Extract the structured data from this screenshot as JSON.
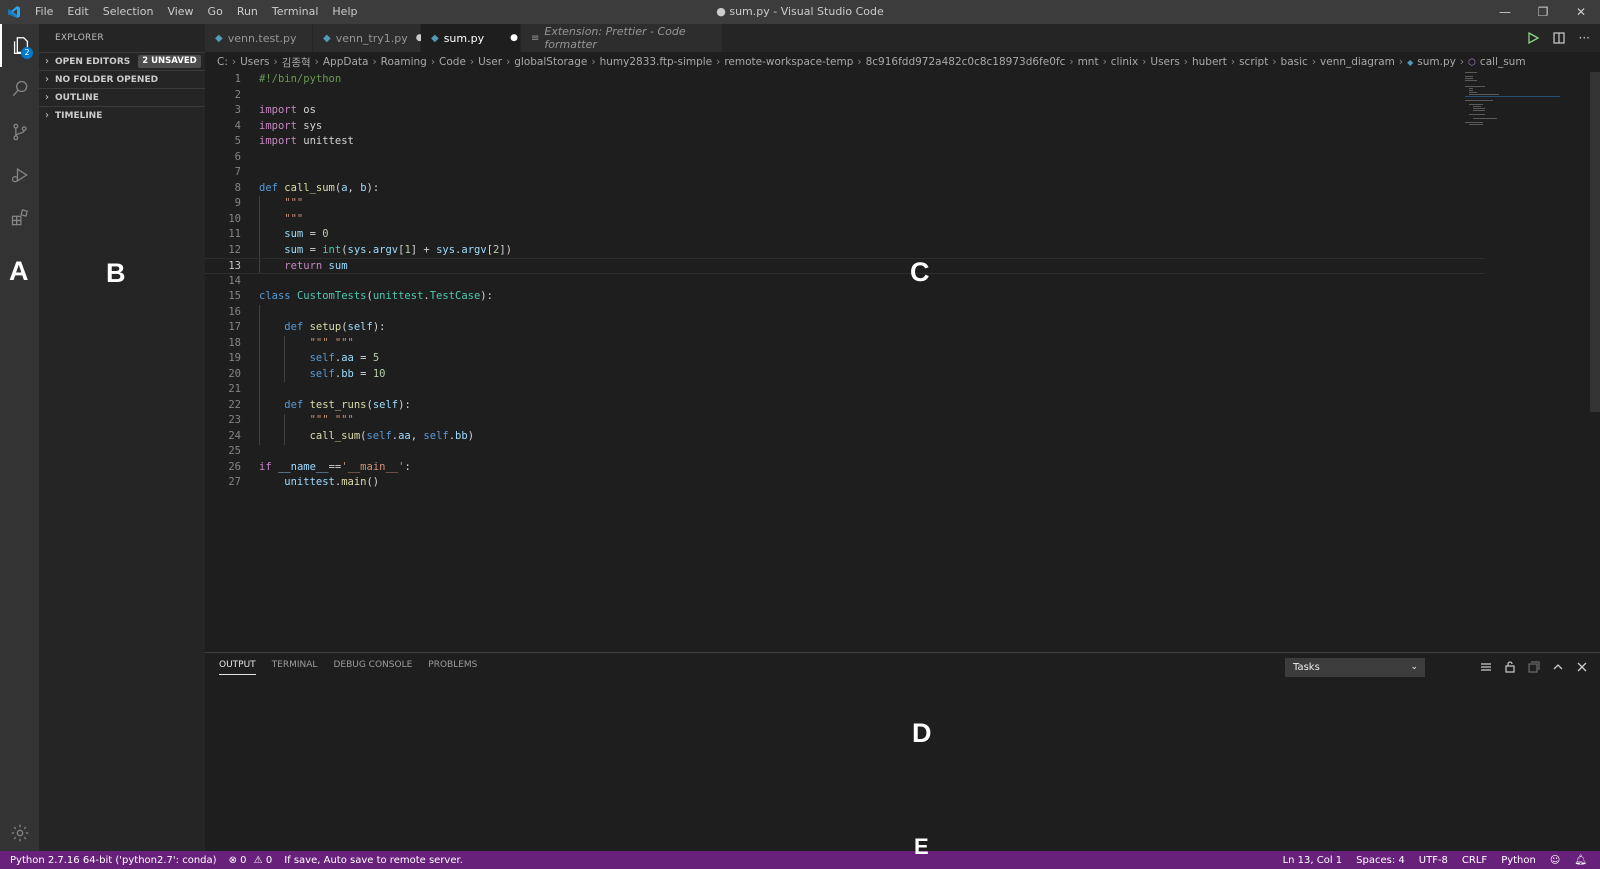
{
  "titlebar": {
    "menu": [
      "File",
      "Edit",
      "Selection",
      "View",
      "Go",
      "Run",
      "Terminal",
      "Help"
    ],
    "title": "● sum.py - Visual Studio Code",
    "controls": {
      "minimize": "—",
      "restore": "❐",
      "close": "✕"
    }
  },
  "activitybar": {
    "explorer_badge": "2",
    "icons": [
      "files-icon",
      "search-icon",
      "source-control-icon",
      "run-debug-icon",
      "extensions-icon"
    ],
    "bottom_icon": "gear-icon"
  },
  "sidebar": {
    "header": "EXPLORER",
    "sections": [
      {
        "label": "OPEN EDITORS",
        "badge": "2 UNSAVED"
      },
      {
        "label": "NO FOLDER OPENED"
      },
      {
        "label": "OUTLINE"
      },
      {
        "label": "TIMELINE"
      }
    ]
  },
  "tabs": [
    {
      "label": "venn.test.py",
      "dirty": ""
    },
    {
      "label": "venn_try1.py",
      "dirty": "●"
    },
    {
      "label": "sum.py",
      "dirty": "●"
    },
    {
      "label": "Extension: Prettier - Code formatter",
      "dirty": ""
    }
  ],
  "breadcrumb": [
    "C:",
    "Users",
    "김종혁",
    "AppData",
    "Roaming",
    "Code",
    "User",
    "globalStorage",
    "humy2833.ftp-simple",
    "remote-workspace-temp",
    "8c916fdd972a482c0c8c18973d6fe0fc",
    "mnt",
    "clinix",
    "Users",
    "hubert",
    "script",
    "basic",
    "venn_diagram",
    "sum.py",
    "call_sum"
  ],
  "editor": {
    "current_line": 13,
    "lines": [
      {
        "n": "1",
        "code": [
          [
            "cmt",
            "#!/bin/python"
          ]
        ]
      },
      {
        "n": "2",
        "code": []
      },
      {
        "n": "3",
        "code": [
          [
            "ctl",
            "import"
          ],
          [
            "txt",
            " os"
          ]
        ]
      },
      {
        "n": "4",
        "code": [
          [
            "ctl",
            "import"
          ],
          [
            "txt",
            " sys"
          ]
        ]
      },
      {
        "n": "5",
        "code": [
          [
            "ctl",
            "import"
          ],
          [
            "txt",
            " unittest"
          ]
        ]
      },
      {
        "n": "6",
        "code": []
      },
      {
        "n": "7",
        "code": []
      },
      {
        "n": "8",
        "code": [
          [
            "kw",
            "def"
          ],
          [
            "txt",
            " "
          ],
          [
            "fn",
            "call_sum"
          ],
          [
            "txt",
            "("
          ],
          [
            "var",
            "a"
          ],
          [
            "txt",
            ", "
          ],
          [
            "var",
            "b"
          ],
          [
            "txt",
            "):"
          ]
        ]
      },
      {
        "n": "9",
        "code": [
          [
            "str",
            "    \"\"\""
          ]
        ]
      },
      {
        "n": "10",
        "code": [
          [
            "str",
            "    \"\"\""
          ]
        ]
      },
      {
        "n": "11",
        "code": [
          [
            "var",
            "    sum"
          ],
          [
            "txt",
            " = "
          ],
          [
            "num",
            "0"
          ]
        ]
      },
      {
        "n": "12",
        "code": [
          [
            "var",
            "    sum"
          ],
          [
            "txt",
            " = "
          ],
          [
            "cls",
            "int"
          ],
          [
            "txt",
            "("
          ],
          [
            "var",
            "sys"
          ],
          [
            "txt",
            "."
          ],
          [
            "var",
            "argv"
          ],
          [
            "txt",
            "["
          ],
          [
            "num",
            "1"
          ],
          [
            "txt",
            "] + "
          ],
          [
            "var",
            "sys"
          ],
          [
            "txt",
            "."
          ],
          [
            "var",
            "argv"
          ],
          [
            "txt",
            "["
          ],
          [
            "num",
            "2"
          ],
          [
            "txt",
            "])"
          ]
        ]
      },
      {
        "n": "13",
        "code": [
          [
            "ctl",
            "    return"
          ],
          [
            "txt",
            " "
          ],
          [
            "var",
            "sum"
          ]
        ]
      },
      {
        "n": "14",
        "code": []
      },
      {
        "n": "15",
        "code": [
          [
            "kw",
            "class"
          ],
          [
            "txt",
            " "
          ],
          [
            "cls",
            "CustomTests"
          ],
          [
            "txt",
            "("
          ],
          [
            "cls",
            "unittest"
          ],
          [
            "txt",
            "."
          ],
          [
            "cls",
            "TestCase"
          ],
          [
            "txt",
            "):"
          ]
        ]
      },
      {
        "n": "16",
        "code": []
      },
      {
        "n": "17",
        "code": [
          [
            "kw",
            "    def"
          ],
          [
            "txt",
            " "
          ],
          [
            "fn",
            "setup"
          ],
          [
            "txt",
            "("
          ],
          [
            "var",
            "self"
          ],
          [
            "txt",
            "):"
          ]
        ]
      },
      {
        "n": "18",
        "code": [
          [
            "str",
            "        \"\"\" \"\"\""
          ]
        ]
      },
      {
        "n": "19",
        "code": [
          [
            "kw",
            "        self"
          ],
          [
            "txt",
            "."
          ],
          [
            "var",
            "aa"
          ],
          [
            "txt",
            " = "
          ],
          [
            "num",
            "5"
          ]
        ]
      },
      {
        "n": "20",
        "code": [
          [
            "kw",
            "        self"
          ],
          [
            "txt",
            "."
          ],
          [
            "var",
            "bb"
          ],
          [
            "txt",
            " = "
          ],
          [
            "num",
            "10"
          ]
        ]
      },
      {
        "n": "21",
        "code": []
      },
      {
        "n": "22",
        "code": [
          [
            "kw",
            "    def"
          ],
          [
            "txt",
            " "
          ],
          [
            "fn",
            "test_runs"
          ],
          [
            "txt",
            "("
          ],
          [
            "var",
            "self"
          ],
          [
            "txt",
            "):"
          ]
        ]
      },
      {
        "n": "23",
        "code": [
          [
            "str",
            "        \"\"\" \"\"\""
          ]
        ]
      },
      {
        "n": "24",
        "code": [
          [
            "fn",
            "        call_sum"
          ],
          [
            "txt",
            "("
          ],
          [
            "kw",
            "self"
          ],
          [
            "txt",
            "."
          ],
          [
            "var",
            "aa"
          ],
          [
            "txt",
            ", "
          ],
          [
            "kw",
            "self"
          ],
          [
            "txt",
            "."
          ],
          [
            "var",
            "bb"
          ],
          [
            "txt",
            ")"
          ]
        ]
      },
      {
        "n": "25",
        "code": []
      },
      {
        "n": "26",
        "code": [
          [
            "ctl",
            "if"
          ],
          [
            "txt",
            " "
          ],
          [
            "var",
            "__name__"
          ],
          [
            "txt",
            "=="
          ],
          [
            "str",
            "'__main__'"
          ],
          [
            "txt",
            ":"
          ]
        ]
      },
      {
        "n": "27",
        "code": [
          [
            "var",
            "    unittest"
          ],
          [
            "txt",
            "."
          ],
          [
            "fn",
            "main"
          ],
          [
            "txt",
            "()"
          ]
        ]
      }
    ]
  },
  "panel": {
    "tabs": [
      "OUTPUT",
      "TERMINAL",
      "DEBUG CONSOLE",
      "PROBLEMS"
    ],
    "active_tab": "OUTPUT",
    "select_value": "Tasks"
  },
  "statusbar": {
    "interpreter": "Python 2.7.16 64-bit ('python2.7': conda)",
    "errors": "⊗ 0",
    "warnings": "⚠ 0",
    "message": "If save, Auto save to remote server.",
    "position": "Ln 13, Col 1",
    "spaces": "Spaces: 4",
    "encoding": "UTF-8",
    "eol": "CRLF",
    "language": "Python",
    "bg_color": "#68217a"
  },
  "overlay_labels": [
    "A",
    "B",
    "C",
    "D",
    "E"
  ]
}
